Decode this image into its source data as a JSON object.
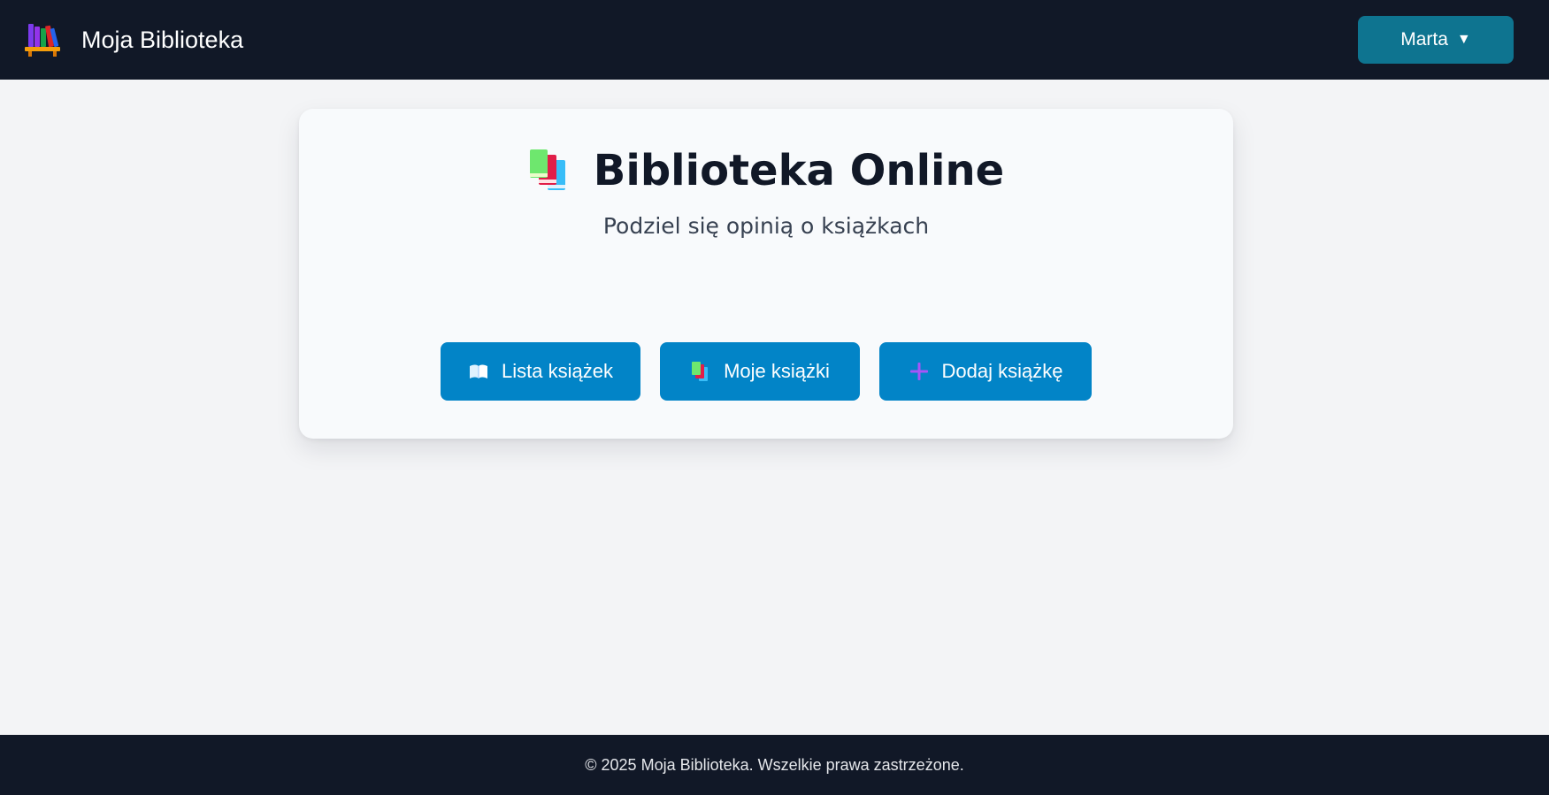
{
  "header": {
    "brand_icon": "books-on-shelf-icon",
    "brand_title": "Moja Biblioteka",
    "user_name": "Marta",
    "user_caret": "▼"
  },
  "hero": {
    "title_icon": "books-stack-icon",
    "title": "Biblioteka Online",
    "subtitle": "Podziel się opinią o książkach"
  },
  "actions": [
    {
      "icon": "open-book-icon",
      "label": "Lista książek"
    },
    {
      "icon": "books-stack-icon",
      "label": "Moje książki"
    },
    {
      "icon": "plus-icon",
      "label": "Dodaj książkę"
    }
  ],
  "footer": {
    "text": "© 2025 Moja Biblioteka. Wszelkie prawa zastrzeżone."
  },
  "colors": {
    "header_bg": "#111827",
    "user_button": "#0e7490",
    "action_button": "#0284c7",
    "page_bg": "#f3f4f6",
    "card_bg": "#f8fafc"
  }
}
